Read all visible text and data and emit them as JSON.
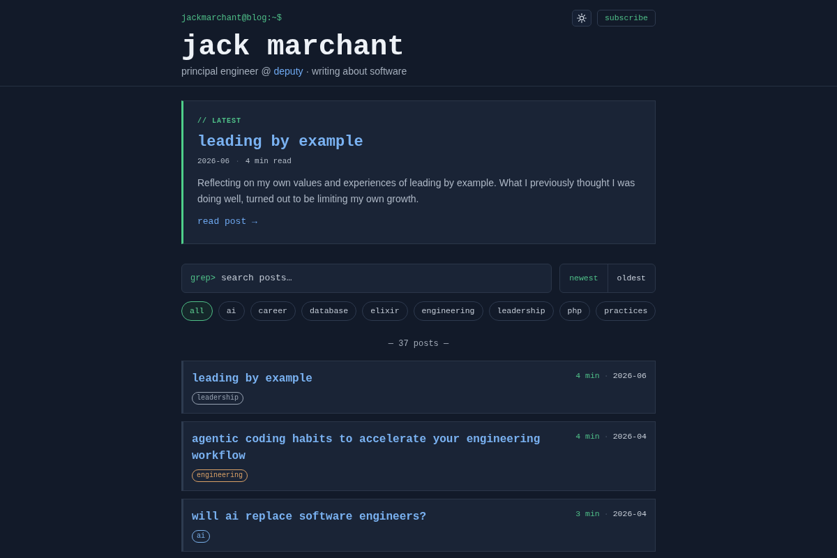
{
  "header": {
    "prompt": "jackmarchant@blog:~$",
    "subscribe": "subscribe",
    "title": "jack marchant",
    "tagline": {
      "before": "principal engineer @ ",
      "link": "deputy",
      "after": " · writing about software"
    }
  },
  "latest": {
    "label": "// LATEST",
    "title": "leading by example",
    "date": "2026-06",
    "separator": "·",
    "read_time": "4 min read",
    "excerpt": "Reflecting on my own values and experiences of leading by example. What I previously thought I was doing well, turned out to be limiting my own growth.",
    "link": "read post →"
  },
  "search": {
    "prompt": "grep>",
    "placeholder": "search posts…"
  },
  "sort": [
    {
      "label": "newest",
      "selected": true
    },
    {
      "label": "oldest",
      "selected": false
    }
  ],
  "tags": [
    {
      "label": "all",
      "selected": true
    },
    {
      "label": "ai",
      "selected": false
    },
    {
      "label": "career",
      "selected": false
    },
    {
      "label": "database",
      "selected": false
    },
    {
      "label": "elixir",
      "selected": false
    },
    {
      "label": "engineering",
      "selected": false
    },
    {
      "label": "leadership",
      "selected": false
    },
    {
      "label": "php",
      "selected": false
    },
    {
      "label": "practices",
      "selected": false
    }
  ],
  "count": "— 37 posts —",
  "posts": [
    {
      "title": "leading by example",
      "read_time": "4 min",
      "separator": "·",
      "date": "2026-06",
      "tag": {
        "label": "leadership",
        "color": "#98a3b3"
      }
    },
    {
      "title": "agentic coding habits to accelerate your engineering workflow",
      "read_time": "4 min",
      "separator": "·",
      "date": "2026-04",
      "tag": {
        "label": "engineering",
        "color": "#d9a066"
      }
    },
    {
      "title": "will ai replace software engineers?",
      "read_time": "3 min",
      "separator": "·",
      "date": "2026-04",
      "tag": {
        "label": "ai",
        "color": "#7ab0ea"
      }
    }
  ]
}
